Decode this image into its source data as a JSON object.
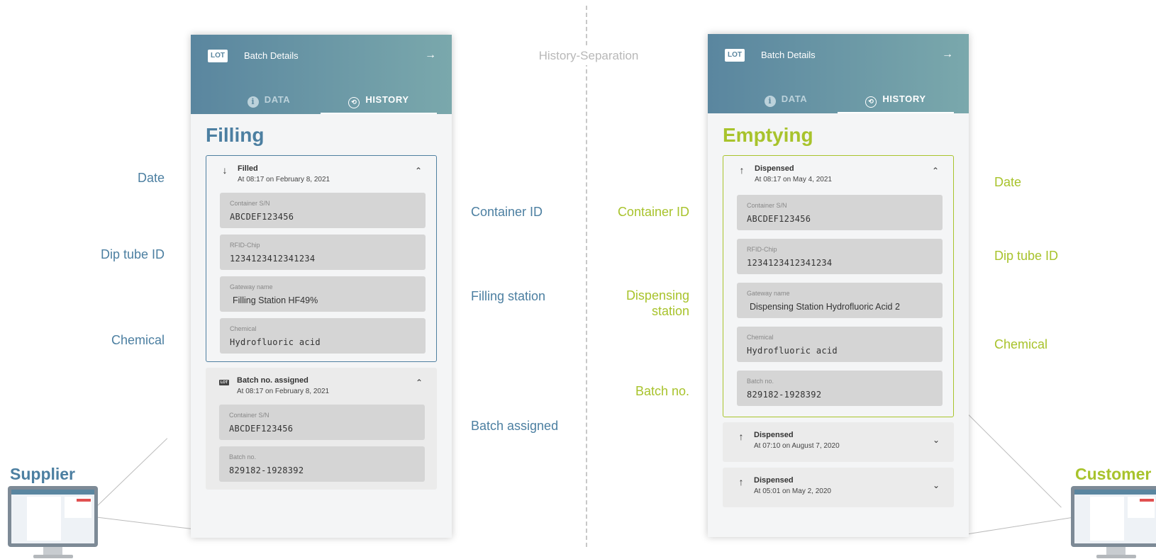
{
  "separator": {
    "label": "History-Separation"
  },
  "supplier": {
    "side_label": "Supplier",
    "header": {
      "lot_badge": "LOT",
      "title": "Batch Details",
      "arrow": "→"
    },
    "tabs": [
      {
        "label": "DATA",
        "icon": "i"
      },
      {
        "label": "HISTORY",
        "icon": "⟲"
      }
    ],
    "section_title": "Filling",
    "events": [
      {
        "icon": "↓",
        "title": "Filled",
        "subtitle": "At 08:17 on February 8, 2021",
        "chevron": "⌃",
        "fields": [
          {
            "label": "Container S/N",
            "value": "ABCDEF123456"
          },
          {
            "label": "RFID-Chip",
            "value": "1234123412341234"
          },
          {
            "label": "Gateway name",
            "value": "Filling Station HF49%"
          },
          {
            "label": "Chemical",
            "value": "Hydrofluoric acid"
          }
        ]
      },
      {
        "icon": "LOT",
        "title": "Batch no. assigned",
        "subtitle": "At 08:17 on February 8, 2021",
        "chevron": "⌃",
        "fields": [
          {
            "label": "Container S/N",
            "value": "ABCDEF123456"
          },
          {
            "label": "Batch no.",
            "value": "829182-1928392"
          }
        ]
      }
    ],
    "annotations_left": [
      "Date",
      "Dip tube ID",
      "Chemical"
    ],
    "annotations_right": [
      "Container ID",
      "Filling station",
      "Batch assigned"
    ]
  },
  "customer": {
    "side_label": "Customer",
    "header": {
      "lot_badge": "LOT",
      "title": "Batch Details",
      "arrow": "→"
    },
    "tabs": [
      {
        "label": "DATA",
        "icon": "i"
      },
      {
        "label": "HISTORY",
        "icon": "⟲"
      }
    ],
    "section_title": "Emptying",
    "events": [
      {
        "icon": "↑",
        "title": "Dispensed",
        "subtitle": "At 08:17 on May 4, 2021",
        "chevron": "⌃",
        "fields": [
          {
            "label": "Container S/N",
            "value": "ABCDEF123456"
          },
          {
            "label": "RFID-Chip",
            "value": "1234123412341234"
          },
          {
            "label": "Gateway name",
            "value": "Dispensing Station Hydrofluoric Acid 2"
          },
          {
            "label": "Chemical",
            "value": "Hydrofluoric acid"
          },
          {
            "label": "Batch no.",
            "value": "829182-1928392"
          }
        ]
      },
      {
        "icon": "↑",
        "title": "Dispensed",
        "subtitle": "At 07:10 on August 7, 2020",
        "chevron": "⌄"
      },
      {
        "icon": "↑",
        "title": "Dispensed",
        "subtitle": "At 05:01 on May 2, 2020",
        "chevron": "⌄"
      }
    ],
    "annotations_left": [
      "Container ID",
      "Dispensing station",
      "Batch no."
    ],
    "annotations_right": [
      "Date",
      "Dip tube ID",
      "Chemical"
    ]
  },
  "colors": {
    "supplier_accent": "#4c7fa1",
    "customer_accent": "#a8c32c",
    "header_gradient_start": "#5a869f",
    "header_gradient_end": "#7aa8ac"
  }
}
